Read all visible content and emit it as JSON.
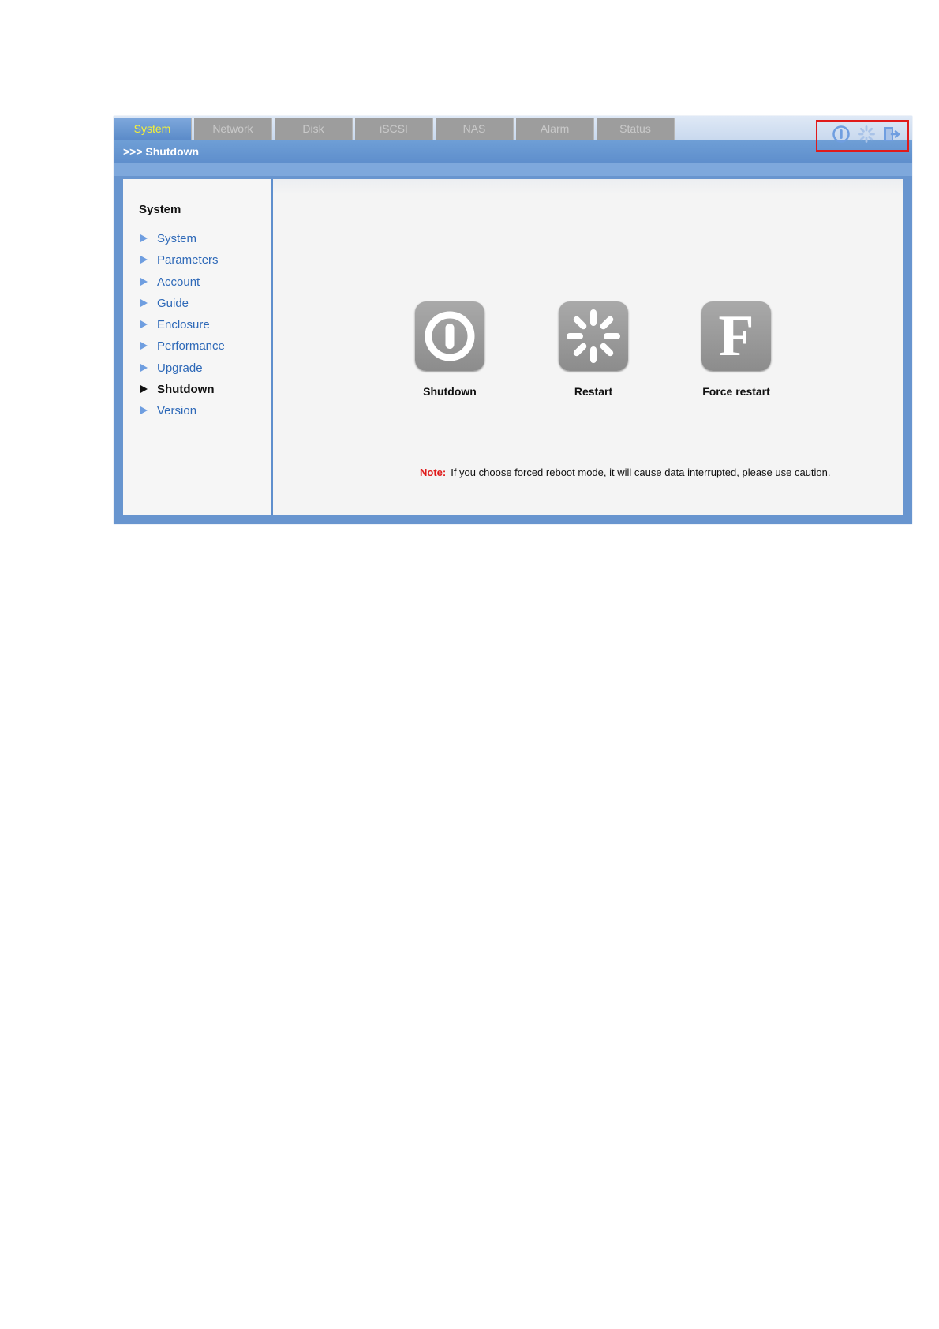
{
  "tabs": [
    {
      "label": "System",
      "active": true
    },
    {
      "label": "Network",
      "active": false
    },
    {
      "label": "Disk",
      "active": false
    },
    {
      "label": "iSCSI",
      "active": false
    },
    {
      "label": "NAS",
      "active": false
    },
    {
      "label": "Alarm",
      "active": false
    },
    {
      "label": "Status",
      "active": false
    }
  ],
  "breadcrumb": ">>> Shutdown",
  "header_icons": [
    "power-icon",
    "restart-spinner-icon",
    "logout-icon"
  ],
  "sidebar": {
    "title": "System",
    "items": [
      {
        "label": "System",
        "active": false
      },
      {
        "label": "Parameters",
        "active": false
      },
      {
        "label": "Account",
        "active": false
      },
      {
        "label": "Guide",
        "active": false
      },
      {
        "label": "Enclosure",
        "active": false
      },
      {
        "label": "Performance",
        "active": false
      },
      {
        "label": "Upgrade",
        "active": false
      },
      {
        "label": "Shutdown",
        "active": true
      },
      {
        "label": "Version",
        "active": false
      }
    ]
  },
  "actions": {
    "shutdown": {
      "label": "Shutdown",
      "icon": "power-icon"
    },
    "restart": {
      "label": "Restart",
      "icon": "restart-spinner-icon"
    },
    "force_restart": {
      "label": "Force restart",
      "icon": "force-restart-icon",
      "glyph": "F"
    }
  },
  "note": {
    "label": "Note:",
    "text": "If you choose forced reboot mode, it will cause data interrupted, please use caution."
  },
  "colors": {
    "accent": "#6895cf",
    "active_tab_text": "#f3ef3a",
    "note_label": "#e01a1a",
    "link": "#2e69b8"
  }
}
